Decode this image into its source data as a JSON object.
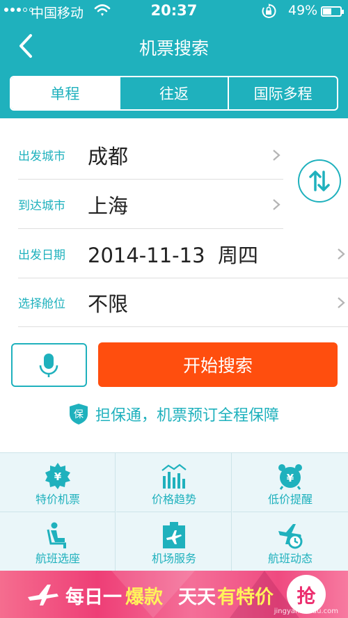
{
  "status_bar": {
    "carrier": "中国移动",
    "time": "20:37",
    "battery_percent": "49%",
    "battery_level": 0.49
  },
  "header": {
    "title": "机票搜索",
    "back_icon": "back-chevron-icon"
  },
  "trip_tabs": [
    {
      "label": "单程",
      "active": true
    },
    {
      "label": "往返",
      "active": false
    },
    {
      "label": "国际多程",
      "active": false
    }
  ],
  "form": {
    "departure_label": "出发城市",
    "departure_value": "成都",
    "arrival_label": "到达城市",
    "arrival_value": "上海",
    "date_label": "出发日期",
    "date_value": "2014-11-13  周四",
    "cabin_label": "选择舱位",
    "cabin_value": "不限"
  },
  "actions": {
    "search_label": "开始搜索",
    "voice_icon": "microphone-icon",
    "swap_icon": "swap-arrows-icon"
  },
  "guarantee": {
    "badge": "保",
    "text": "担保通，机票预订全程保障"
  },
  "features": [
    {
      "label": "特价机票",
      "icon": "yen-badge-icon"
    },
    {
      "label": "价格趋势",
      "icon": "bar-trend-icon"
    },
    {
      "label": "低价提醒",
      "icon": "alarm-clock-yen-icon"
    },
    {
      "label": "航班选座",
      "icon": "seat-icon"
    },
    {
      "label": "机场服务",
      "icon": "airport-service-icon"
    },
    {
      "label": "航班动态",
      "icon": "flight-status-icon"
    }
  ],
  "banner": {
    "part1": "每日一",
    "part2": "爆款",
    "part3": "天天",
    "part4": "有特价",
    "grab": "抢",
    "watermark": "jingyan.baidu.com"
  },
  "colors": {
    "primary": "#1fb1bd",
    "search_button": "#ff4e0e",
    "banner": "#ee3e76"
  }
}
